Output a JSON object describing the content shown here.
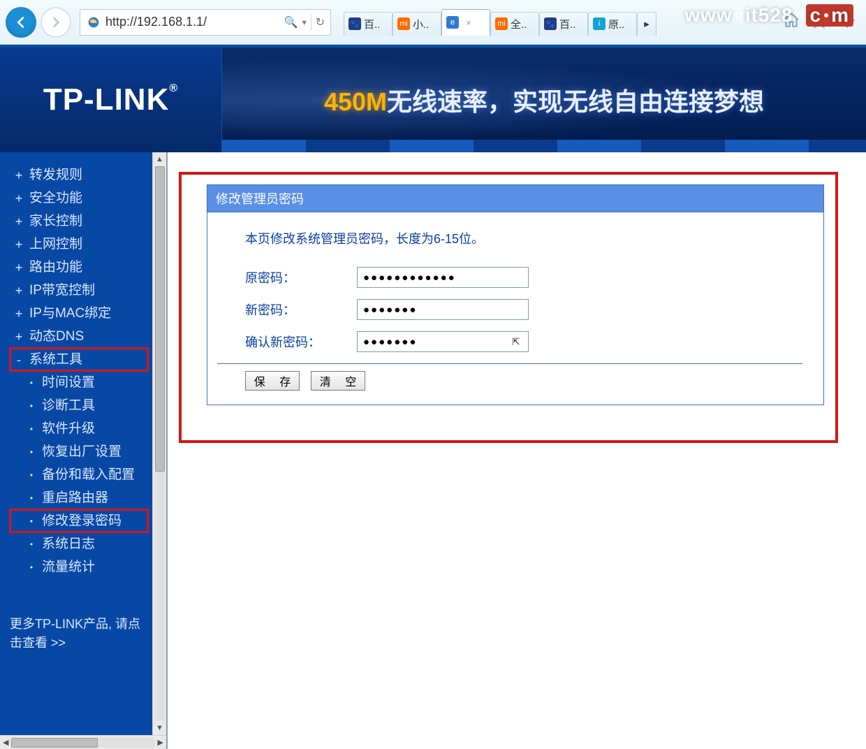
{
  "watermark": "www.it528.com",
  "browser": {
    "url": "http://192.168.1.1/",
    "tabs": [
      {
        "label": "百..",
        "favicon_bg": "#243a8a",
        "favicon_text": "🐾"
      },
      {
        "label": "小..",
        "favicon_bg": "#ff6a00",
        "favicon_text": "mi"
      },
      {
        "label": "",
        "favicon_bg": "#2e7bd1",
        "favicon_text": "e",
        "active": true,
        "closable": true
      },
      {
        "label": "全..",
        "favicon_bg": "#ff6a00",
        "favicon_text": "mi"
      },
      {
        "label": "百..",
        "favicon_bg": "#243a8a",
        "favicon_text": "🐾"
      },
      {
        "label": "原..",
        "favicon_bg": "#17a1d6",
        "favicon_text": "i"
      }
    ]
  },
  "logo": "TP-LINK",
  "slogan_accent": "450M",
  "slogan_rest": "无线速率，实现无线自由连接梦想",
  "sidebar": {
    "top_items": [
      "转发规则",
      "安全功能",
      "家长控制",
      "上网控制",
      "路由功能",
      "IP带宽控制",
      "IP与MAC绑定",
      "动态DNS"
    ],
    "expanded": "系统工具",
    "sub_items": [
      "时间设置",
      "诊断工具",
      "软件升级",
      "恢复出厂设置",
      "备份和载入配置",
      "重启路由器",
      "修改登录密码",
      "系统日志",
      "流量统计"
    ],
    "highlight_sub": "修改登录密码",
    "more": "更多TP-LINK产品,\n请点击查看 >>"
  },
  "panel": {
    "title": "修改管理员密码",
    "hint": "本页修改系统管理员密码，长度为6-15位。",
    "old_label": "原密码：",
    "new_label": "新密码：",
    "confirm_label": "确认新密码：",
    "old_value": "●●●●●●●●●●●●",
    "new_value": "●●●●●●●",
    "confirm_value": "●●●●●●●",
    "save": "保 存",
    "clear": "清 空"
  }
}
